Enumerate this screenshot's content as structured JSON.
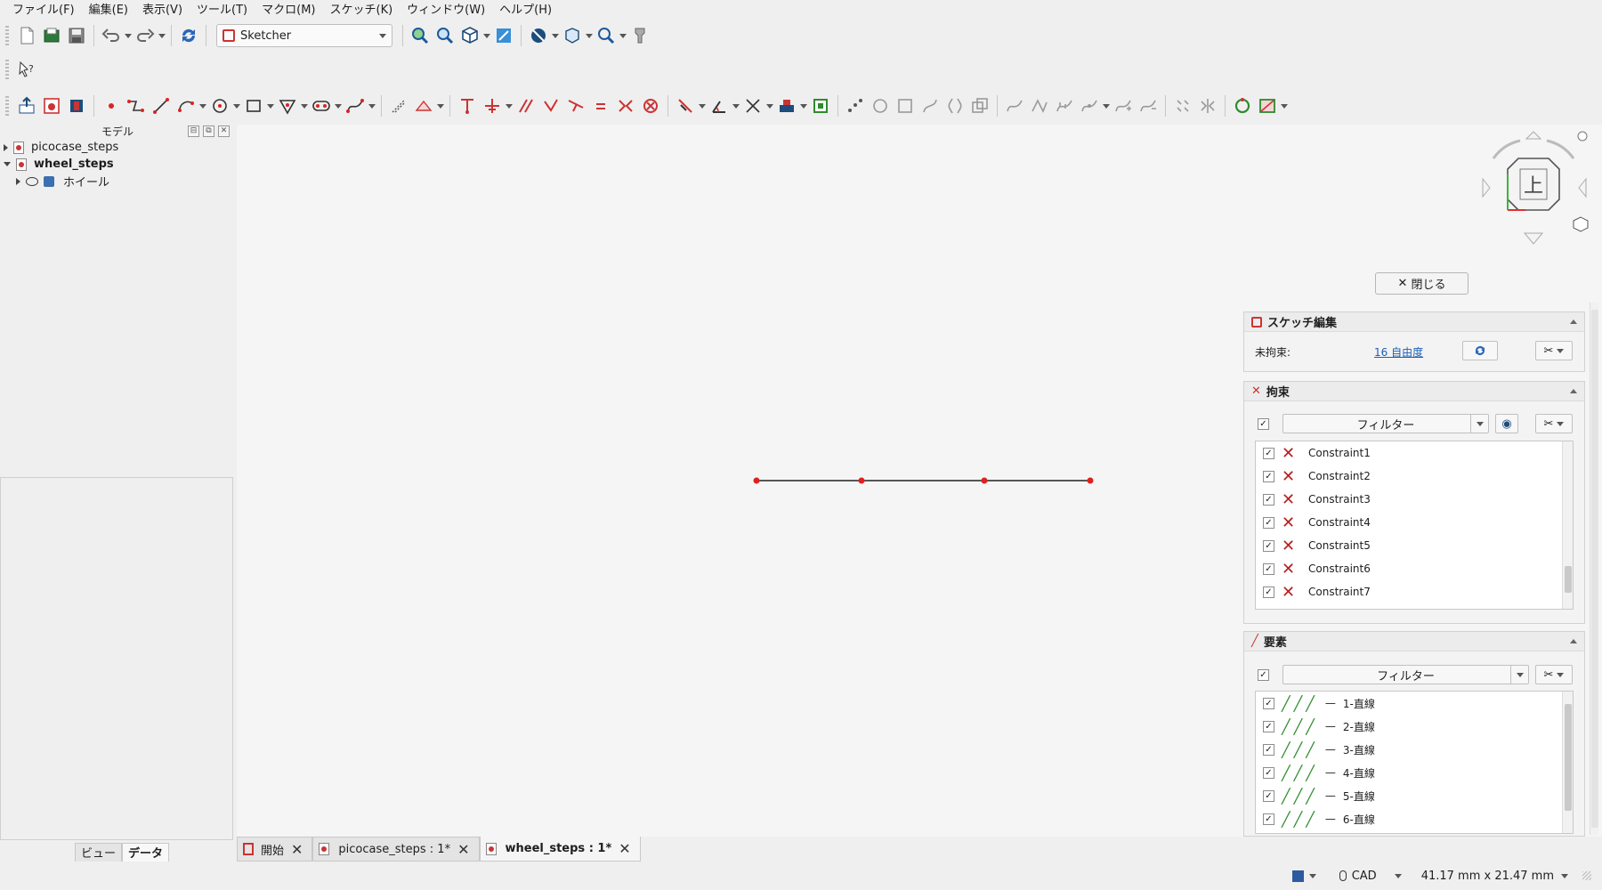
{
  "menu": [
    "ファイル(F)",
    "編集(E)",
    "表示(V)",
    "ツール(T)",
    "マクロ(M)",
    "スケッチ(K)",
    "ウィンドウ(W)",
    "ヘルプ(H)"
  ],
  "workbench": {
    "selected": "Sketcher"
  },
  "tree": {
    "title": "モデル",
    "items": [
      {
        "label": "picocase_steps"
      },
      {
        "label": "wheel_steps"
      },
      {
        "label": "ホイール"
      }
    ]
  },
  "panel_tabs": {
    "view": "ビュー",
    "data": "データ"
  },
  "doc_tabs": [
    {
      "label": "開始"
    },
    {
      "label": "picocase_steps : 1*"
    },
    {
      "label": "wheel_steps : 1*"
    }
  ],
  "navcube": {
    "face": "上"
  },
  "task": {
    "close_label": "閉じる",
    "sketch_edit": {
      "title": "スケッチ編集",
      "unconstrained_label": "未拘束:",
      "dof_link": "16 自由度"
    },
    "constraints": {
      "title": "拘束",
      "filter": "フィルター",
      "items": [
        "Constraint1",
        "Constraint2",
        "Constraint3",
        "Constraint4",
        "Constraint5",
        "Constraint6",
        "Constraint7"
      ]
    },
    "elements": {
      "title": "要素",
      "filter": "フィルター",
      "items": [
        "1-直線",
        "2-直線",
        "3-直線",
        "4-直線",
        "5-直線",
        "6-直線"
      ]
    }
  },
  "status": {
    "nav_style": "CAD",
    "dimensions": "41.17 mm x 21.47 mm"
  }
}
